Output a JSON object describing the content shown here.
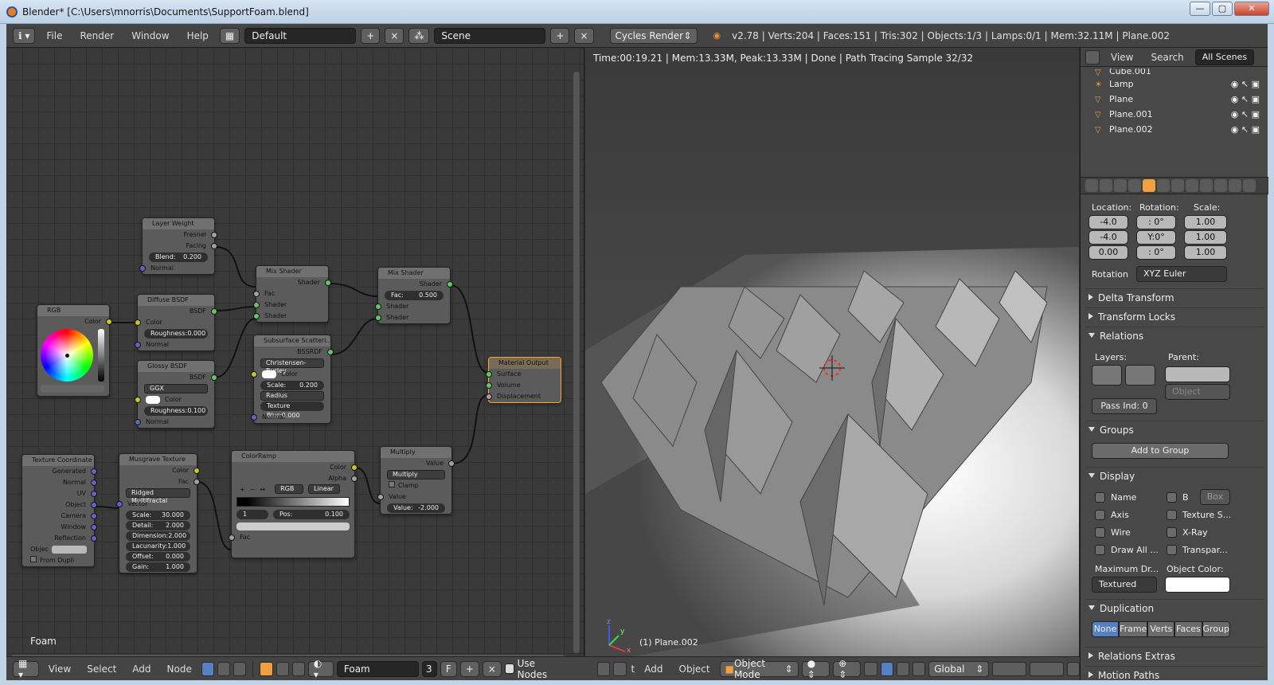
{
  "window": {
    "title": "Blender* [C:\\Users\\mnorris\\Documents\\SupportFoam.blend]",
    "minimize": "—",
    "maximize": "▢",
    "close": "✕"
  },
  "infobar": {
    "menus": [
      "File",
      "Render",
      "Window",
      "Help"
    ],
    "layout": "Default",
    "scene": "Scene",
    "engine": "Cycles Render",
    "stats": "v2.78 | Verts:204 | Faces:151 | Tris:302 | Objects:1/3 | Lamps:0/1 | Mem:32.11M | Plane.002"
  },
  "node_editor": {
    "material": "Foam",
    "nodes": {
      "layer_weight": {
        "title": "Layer Weight",
        "fresnel": "Fresnel",
        "facing": "Facing",
        "blend_label": "Blend:",
        "blend": "0.200",
        "normal": "Normal"
      },
      "rgb": {
        "title": "RGB",
        "color": "Color"
      },
      "diffuse": {
        "title": "Diffuse BSDF",
        "out": "BSDF",
        "color": "Color",
        "roughness": "Roughness:0.000",
        "normal": "Normal"
      },
      "glossy": {
        "title": "Glossy BSDF",
        "out": "BSDF",
        "dist": "GGX",
        "color": "Color",
        "roughness": "Roughness:0.100",
        "normal": "Normal"
      },
      "mix1": {
        "title": "Mix Shader",
        "out": "Shader",
        "fac": "Fac",
        "s1": "Shader",
        "s2": "Shader"
      },
      "sss": {
        "title": "Subsurface Scatteri...",
        "out": "BSSRDF",
        "method": "Christensen-Burley",
        "color": "Color",
        "scale_label": "Scale:",
        "scale": "0.200",
        "radius": "Radius",
        "blur": "Texture Blur:0.000",
        "normal": "Normal"
      },
      "mix2": {
        "title": "Mix Shader",
        "out": "Shader",
        "fac_label": "Fac:",
        "fac": "0.500",
        "s1": "Shader",
        "s2": "Shader"
      },
      "output": {
        "title": "Material Output",
        "surface": "Surface",
        "volume": "Volume",
        "disp": "Displacement"
      },
      "texcoord": {
        "title": "Texture Coordinate",
        "outs": [
          "Generated",
          "Normal",
          "UV",
          "Object",
          "Camera",
          "Window",
          "Reflection"
        ],
        "objec": "Objec",
        "from_dupli": "From Dupli"
      },
      "musgrave": {
        "title": "Musgrave Texture",
        "color": "Color",
        "fac": "Fac",
        "type": "Ridged Multifractal",
        "vector": "Vector",
        "params": [
          [
            "Scale:",
            "30.000"
          ],
          [
            "Detail:",
            "2.000"
          ],
          [
            "Dimension:",
            "2.000"
          ],
          [
            "Lacunarity:",
            "1.000"
          ],
          [
            "Offset:",
            "0.000"
          ],
          [
            "Gain:",
            "1.000"
          ]
        ]
      },
      "colorramp": {
        "title": "ColorRamp",
        "color": "Color",
        "alpha": "Alpha",
        "plus": "+",
        "minus": "−",
        "flip": "↔",
        "mode": "RGB",
        "interp": "Linear",
        "index": "1",
        "pos_label": "Pos:",
        "pos": "0.100",
        "fac": "Fac"
      },
      "multiply": {
        "title": "Multiply",
        "out": "Value",
        "op": "Multiply",
        "clamp": "Clamp",
        "value": "Value",
        "v_label": "Value:",
        "v": "-2.000"
      }
    }
  },
  "viewport": {
    "info": "Time:00:19.21 | Mem:13.33M, Peak:13.33M | Done | Path Tracing Sample 32/32",
    "object": "(1) Plane.002",
    "axis_x": "x",
    "axis_y": "y",
    "axis_z": "z"
  },
  "outliner": {
    "menus": [
      "View",
      "Search"
    ],
    "filter": "All Scenes",
    "items": [
      "Cube.001",
      "Lamp",
      "Plane",
      "Plane.001",
      "Plane.002"
    ]
  },
  "properties": {
    "location": "Location:",
    "rotation": "Rotation:",
    "scale": "Scale:",
    "loc": [
      "-4.0",
      "-4.0",
      "0.00"
    ],
    "rot": [
      ": 0°",
      "Y:0°",
      ": 0°"
    ],
    "scl": [
      "1.00",
      "1.00",
      "1.00"
    ],
    "rot_mode_label": "Rotation",
    "rot_mode": "XYZ Euler",
    "delta": "Delta Transform",
    "locks": "Transform Locks",
    "relations": "Relations",
    "layers": "Layers:",
    "parent": "Parent:",
    "parent_type": "Object",
    "pass_index": "Pass Ind: 0",
    "groups": "Groups",
    "add_to_group": "Add to Group",
    "display": "Display",
    "name": "Name",
    "b": "B",
    "box": "Box",
    "axis": "Axis",
    "texture_s": "Texture S...",
    "wire": "Wire",
    "xray": "X-Ray",
    "draw_all": "Draw All ...",
    "transpar": "Transpar...",
    "max_draw": "Maximum Dr...",
    "object_color": "Object Color:",
    "textured": "Textured",
    "duplication": "Duplication",
    "dup": [
      "None",
      "Frame",
      "Verts",
      "Faces",
      "Group"
    ],
    "relations_extras": "Relations Extras",
    "motion_paths": "Motion Paths"
  },
  "bottom": {
    "menus": [
      "View",
      "Select",
      "Add",
      "Node"
    ],
    "material": "Foam",
    "users": "3",
    "f": "F",
    "use_nodes": "Use Nodes",
    "vp_menus": [
      "Add",
      "Object"
    ],
    "mode": "Object Mode",
    "orientation": "Global",
    "truncated": "t"
  }
}
